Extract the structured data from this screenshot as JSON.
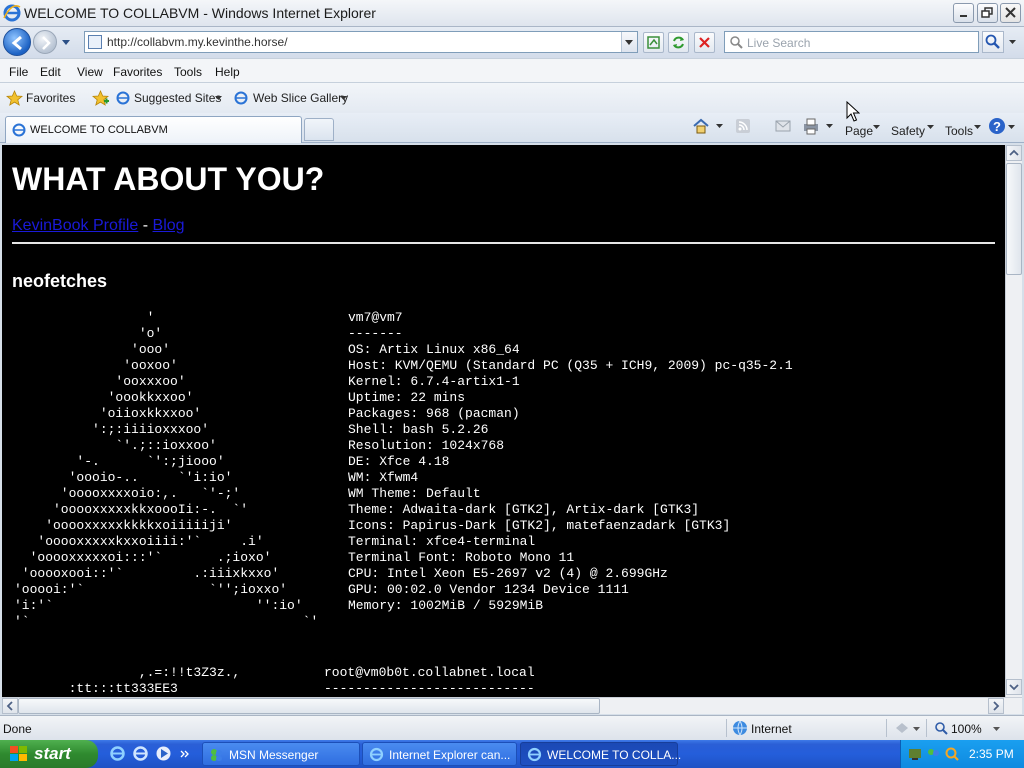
{
  "window": {
    "title": "WELCOME TO COLLABVM - Windows Internet Explorer"
  },
  "addressbar": {
    "url": "http://collabvm.my.kevinthe.horse/",
    "search_placeholder": "Live Search"
  },
  "menu": [
    "File",
    "Edit",
    "View",
    "Favorites",
    "Tools",
    "Help"
  ],
  "favbar": {
    "favorites": "Favorites",
    "suggested": "Suggested Sites",
    "webslice": "Web Slice Gallery"
  },
  "tab": {
    "label": "WELCOME TO COLLABVM"
  },
  "commandbar": {
    "page": "Page",
    "safety": "Safety",
    "tools": "Tools"
  },
  "content": {
    "heading": "WHAT ABOUT YOU?",
    "link1": "KevinBook Profile",
    "link_sep": " - ",
    "link2": "Blog",
    "subheading": "neofetches",
    "ascii_art": "                 '\n                'o'\n               'ooo'\n              'ooxoo'\n             'ooxxxoo'\n            'oookkxxoo'\n           'oiioxkkxxoo'\n          ':;:iiiioxxxoo'\n             `'.;::ioxxoo'\n        '-.      `':;jiooo'\n       'oooio-..     `'i:io'\n      'ooooxxxxoio:,.   `'-;'\n     'ooooxxxxxkkxoooIi:-.  `'\n    'ooooxxxxxkkkkxoiiiiiji'\n   'ooooxxxxxkxxoiiii:'`     .i'\n  'ooooxxxxxoi:::'`       .;ioxo'\n 'ooooxooi::'`         .:iiixkxxo'\n'ooooi:'`                `'';ioxxo'\n'i:'`                          '':io'\n'`                                   `'",
    "info_lines": "vm7@vm7\n-------\nOS: Artix Linux x86_64\nHost: KVM/QEMU (Standard PC (Q35 + ICH9, 2009) pc-q35-2.1\nKernel: 6.7.4-artix1-1\nUptime: 22 mins\nPackages: 968 (pacman)\nShell: bash 5.2.26\nResolution: 1024x768\nDE: Xfce 4.18\nWM: Xfwm4\nWM Theme: Default\nTheme: Adwaita-dark [GTK2], Artix-dark [GTK3]\nIcons: Papirus-Dark [GTK2], matefaenzadark [GTK3]\nTerminal: xfce4-terminal\nTerminal Font: Roboto Mono 11\nCPU: Intel Xeon E5-2697 v2 (4) @ 2.699GHz\nGPU: 00:02.0 Vendor 1234 Device 1111\nMemory: 1002MiB / 5929MiB",
    "ascii_art2": "                ,.=:!!t3Z3z.,\n       :tt:::tt333EE3",
    "info2_lines": "root@vm0b0t.collabnet.local\n---------------------------"
  },
  "statusbar": {
    "status": "Done",
    "zone": "Internet",
    "zoom": "100%"
  },
  "taskbar": {
    "start": "start",
    "buttons": [
      "MSN Messenger",
      "Internet Explorer can...",
      "WELCOME TO COLLA..."
    ],
    "clock": "2:35 PM"
  }
}
